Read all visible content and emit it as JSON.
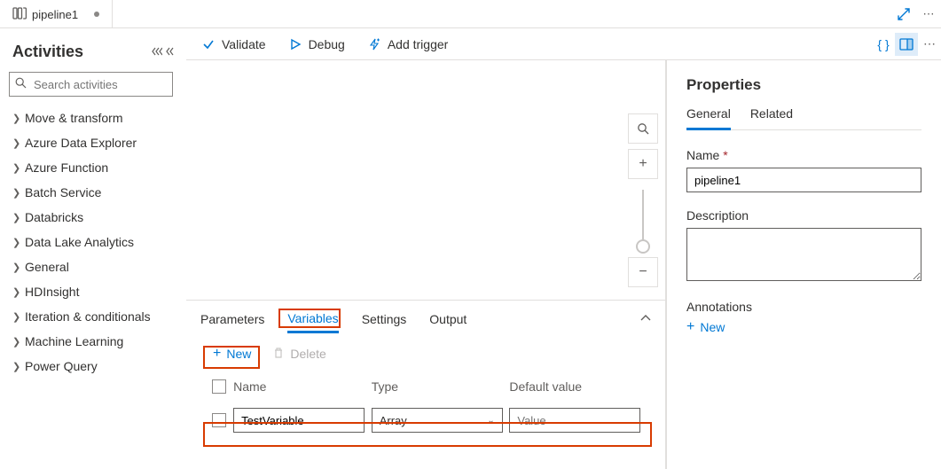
{
  "tab": {
    "title": "pipeline1"
  },
  "activities_panel": {
    "title": "Activities",
    "search_placeholder": "Search activities",
    "categories": [
      "Move & transform",
      "Azure Data Explorer",
      "Azure Function",
      "Batch Service",
      "Databricks",
      "Data Lake Analytics",
      "General",
      "HDInsight",
      "Iteration & conditionals",
      "Machine Learning",
      "Power Query"
    ]
  },
  "toolbar": {
    "validate": "Validate",
    "debug": "Debug",
    "add_trigger": "Add trigger"
  },
  "bottom_panel": {
    "tabs": {
      "parameters": "Parameters",
      "variables": "Variables",
      "settings": "Settings",
      "output": "Output"
    },
    "new_label": "New",
    "delete_label": "Delete",
    "headers": {
      "name": "Name",
      "type": "Type",
      "default": "Default value"
    },
    "row": {
      "name": "TestVariable",
      "type": "Array",
      "default_placeholder": "Value"
    }
  },
  "properties": {
    "title": "Properties",
    "tabs": {
      "general": "General",
      "related": "Related"
    },
    "name_label": "Name",
    "name_value": "pipeline1",
    "description_label": "Description",
    "annotations_label": "Annotations",
    "new_label": "New"
  }
}
